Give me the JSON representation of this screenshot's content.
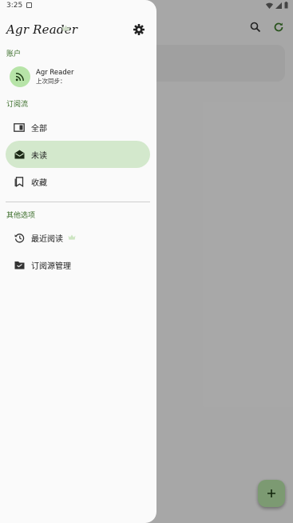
{
  "status_bar": {
    "time": "3:25"
  },
  "drawer": {
    "app_title": "Agr Reader",
    "sections": {
      "account": "账户",
      "feeds": "订阅流",
      "other": "其他选项"
    },
    "account": {
      "name": "Agr Reader",
      "last_sync": "上次同步："
    },
    "nav": [
      {
        "label": "全部",
        "icon": "article-panel-icon"
      },
      {
        "label": "未读",
        "icon": "mail-open-icon",
        "active": true
      },
      {
        "label": "收藏",
        "icon": "bookmark-icon"
      }
    ],
    "other": [
      {
        "label": "最近阅读",
        "icon": "history-icon"
      },
      {
        "label": "订阅源管理",
        "icon": "folder-manage-icon"
      }
    ]
  },
  "colors": {
    "accent_bg": "#d3e8cc",
    "section_text": "#3c6e2b",
    "avatar_bg": "#b7e4a8"
  }
}
